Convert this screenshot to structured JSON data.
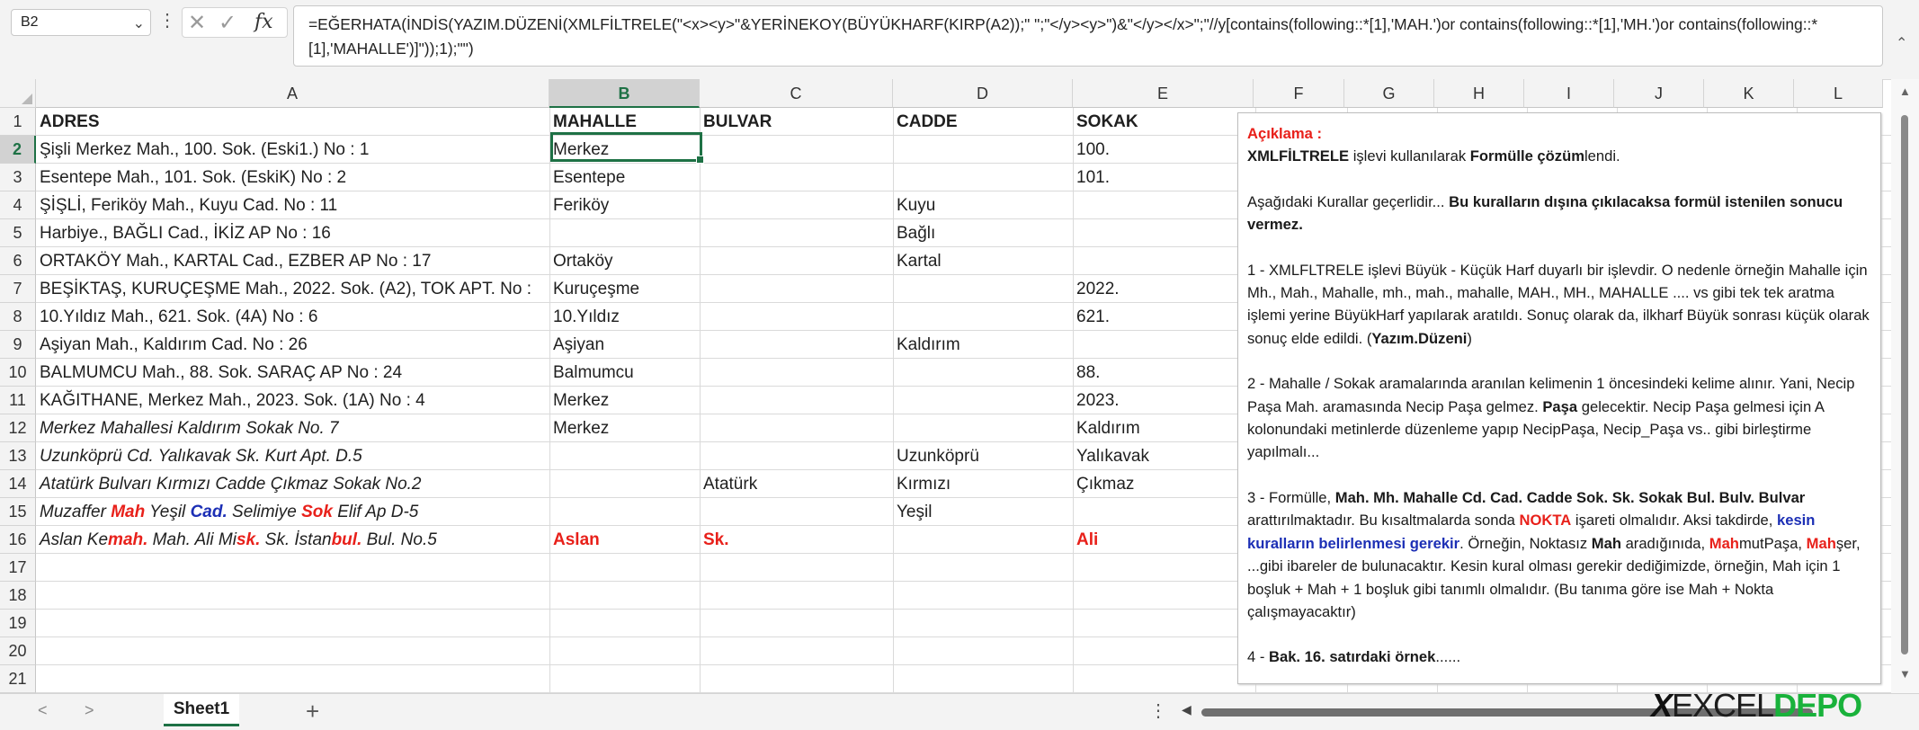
{
  "formula_bar": {
    "name_box": "B2",
    "formula": "=EĞERHATA(İNDİS(YAZIM.DÜZENİ(XMLFİLTRELE(\"<x><y>\"&YERİNEKOY(BÜYÜKHARF(KIRP(A2));\" \";\"</y><y>\")&\"</y></x>\";\"//y[contains(following::*[1],'MAH.')or contains(following::*[1],'MH.')or contains(following::*[1],'MAHALLE')]\"));1);\"\")"
  },
  "columns": [
    "A",
    "B",
    "C",
    "D",
    "E",
    "F",
    "G",
    "H",
    "I",
    "J",
    "K",
    "L"
  ],
  "rows": [
    "1",
    "2",
    "3",
    "4",
    "5",
    "6",
    "7",
    "8",
    "9",
    "10",
    "11",
    "12",
    "13",
    "14",
    "15",
    "16",
    "17",
    "18",
    "19",
    "20",
    "21"
  ],
  "headers": {
    "a": "ADRES",
    "b": "MAHALLE",
    "c": "BULVAR",
    "d": "CADDE",
    "e": "SOKAK"
  },
  "data_rows": [
    {
      "a": "Şişli Merkez Mah., 100. Sok. (Eski1.) No : 1",
      "b": "Merkez",
      "c": "",
      "d": "",
      "e": "100."
    },
    {
      "a": "Esentepe Mah., 101. Sok. (EskiK) No : 2",
      "b": "Esentepe",
      "c": "",
      "d": "",
      "e": "101."
    },
    {
      "a": "ŞİŞLİ, Feriköy Mah., Kuyu Cad. No : 11",
      "b": "Feriköy",
      "c": "",
      "d": "Kuyu",
      "e": ""
    },
    {
      "a": "Harbiye., BAĞLI Cad., İKİZ AP No : 16",
      "b": "",
      "c": "",
      "d": "Bağlı",
      "e": ""
    },
    {
      "a": "ORTAKÖY Mah., KARTAL Cad., EZBER AP No : 17",
      "b": "Ortaköy",
      "c": "",
      "d": "Kartal",
      "e": ""
    },
    {
      "a": "BEŞİKTAŞ, KURUÇEŞME Mah., 2022. Sok. (A2), TOK APT. No :",
      "b": "Kuruçeşme",
      "c": "",
      "d": "",
      "e": "2022."
    },
    {
      "a": "10.Yıldız Mah., 621. Sok. (4A) No : 6",
      "b": "10.Yıldız",
      "c": "",
      "d": "",
      "e": "621."
    },
    {
      "a": "Aşiyan Mah., Kaldırım Cad. No : 26",
      "b": "Aşiyan",
      "c": "",
      "d": "Kaldırım",
      "e": ""
    },
    {
      "a": "BALMUMCU Mah., 88. Sok. SARAÇ AP No : 24",
      "b": "Balmumcu",
      "c": "",
      "d": "",
      "e": "88."
    },
    {
      "a": "KAĞITHANE, Merkez Mah., 2023. Sok. (1A) No : 4",
      "b": "Merkez",
      "c": "",
      "d": "",
      "e": "2023."
    },
    {
      "a": "Merkez Mahallesi Kaldırım Sokak No. 7",
      "b": "Merkez",
      "c": "",
      "d": "",
      "e": "Kaldırım"
    },
    {
      "a": "Uzunköprü Cd. Yalıkavak Sk. Kurt Apt. D.5",
      "b": "",
      "c": "",
      "d": "Uzunköprü",
      "e": "Yalıkavak"
    },
    {
      "a": "Atatürk Bulvarı Kırmızı Cadde Çıkmaz Sokak No.2",
      "b": "",
      "c": "Atatürk",
      "d": "Kırmızı",
      "e": "Çıkmaz"
    }
  ],
  "row15": {
    "a_parts": [
      "Muzaffer ",
      "Mah",
      "  Yeşil ",
      "Cad.",
      "  Selimiye ",
      "Sok",
      " Elif Ap D-5"
    ],
    "d": "Yeşil"
  },
  "row16": {
    "a_parts": [
      "Aslan Ke",
      "mah.",
      "  Mah. Ali Mi",
      "sk.",
      "  Sk. İstan",
      "bul.",
      "  Bul. No.5"
    ],
    "b": "Aslan",
    "c": "Sk.",
    "e": "Ali"
  },
  "note": {
    "title": "Açıklama :",
    "p1": [
      "XMLFİLTRELE",
      " işlevi kullanılarak ",
      "Formülle çözüm",
      "lendi."
    ],
    "p2": [
      "Aşağıdaki Kurallar geçerlidir... ",
      "Bu kuralların dışına çıkılacaksa formül istenilen sonucu vermez."
    ],
    "p3": [
      "1 - XMLFLTRELE işlevi Büyük - Küçük Harf duyarlı bir işlevdir. O nedenle örneğin Mahalle için Mh., Mah., Mahalle, mh., mah., mahalle, MAH., MH., MAHALLE .... vs gibi tek tek aratma işlemi yerine BüyükHarf  yapılarak aratıldı. Sonuç olarak da, ilkharf Büyük sonrası küçük olarak sonuç elde edildi. (",
      "Yazım.Düzeni",
      ")"
    ],
    "p4": [
      "2 - Mahalle / Sokak aramalarında aranılan kelimenin 1 öncesindeki kelime alınır. Yani,  Necip Paşa Mah. aramasında Necip Paşa gelmez. ",
      "Paşa",
      " gelecektir. Necip Paşa gelmesi için A kolonundaki metinlerde düzenleme yapıp NecipPaşa, Necip_Paşa vs.. gibi birleştirme yapılmalı..."
    ],
    "p5": [
      "3 -  Formülle, ",
      "Mah. Mh. Mahalle Cd. Cad. Cadde Sok. Sk. Sokak Bul. Bulv. Bulvar",
      " arattırılmaktadır. Bu kısaltmalarda sonda ",
      "NOKTA",
      " işareti olmalıdır. Aksi takdirde, ",
      "kesin kuralların belirlenmesi gerekir",
      ". Örneğin, Noktasız ",
      "Mah",
      " aradığınıda, ",
      "Mah",
      "mutPaşa, ",
      "Mah",
      "şer, ...gibi ibareler de  bulunacaktır. Kesin kural olması gerekir dediğimizde, örneğin, Mah için 1 boşluk + Mah + 1 boşluk gibi tanımlı olmalıdır. (Bu tanıma göre ise Mah + Nokta çalışmayacaktır)"
    ],
    "p6": [
      "4 - ",
      "Bak. 16. satırdaki örnek",
      "......"
    ]
  },
  "sheet_tab": "Sheet1",
  "logo": {
    "x": "X",
    "excel": "EXCEL",
    "depo": "DEPO"
  },
  "colors": {
    "accent": "#1e7145",
    "red": "#e8201a",
    "blue": "#1c2fb5",
    "logo_green": "#19b23b"
  }
}
